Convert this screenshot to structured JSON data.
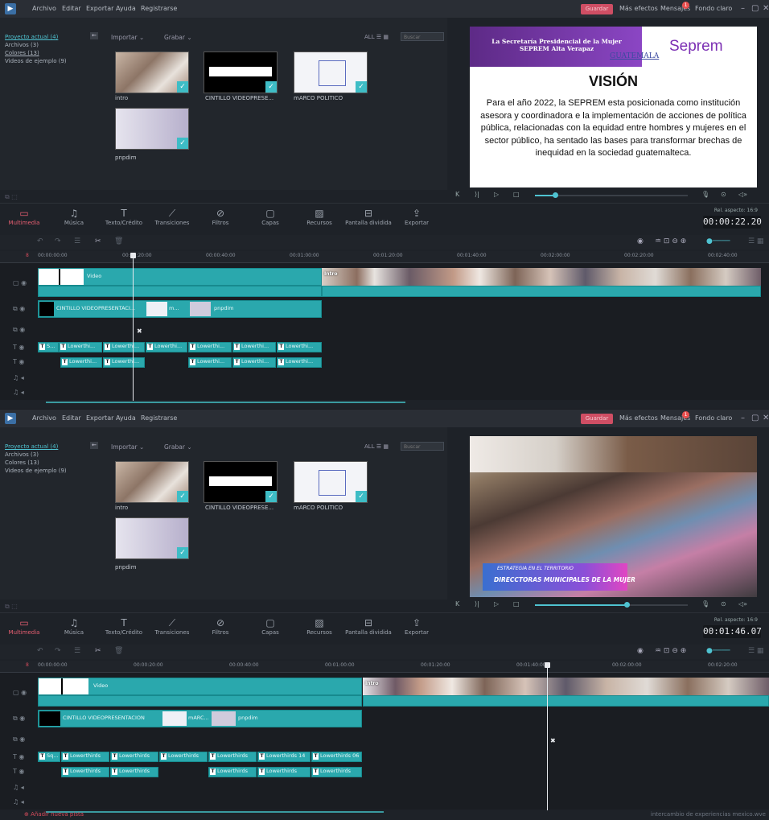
{
  "menu": {
    "items": [
      "Archivo",
      "Editar",
      "Exportar",
      "Ayuda",
      "Registrarse"
    ],
    "save": "Guardar",
    "more_effects": "Más efectos",
    "messages": "Mensajes",
    "messages_badge": "1",
    "theme": "Fondo claro"
  },
  "library": {
    "project": "Proyecto actual (4)",
    "archives": "Archivos (3)",
    "colors": "Colores (13)",
    "samples": "Videos de ejemplo (9)",
    "import": "Importar",
    "record": "Grabar",
    "all": "ALL",
    "search_placeholder": "Buscar",
    "items": [
      {
        "label": "intro",
        "kind": "photo"
      },
      {
        "label": "CINTILLO VIDEOPRESE...",
        "kind": "banner"
      },
      {
        "label": "mARCO POLITICO",
        "kind": "diagram"
      },
      {
        "label": "pnpdim",
        "kind": "slide"
      }
    ]
  },
  "preview_a": {
    "header_left": "La Secretaría Presidencial de la Mujer\nSEPREM Alta Verapaz",
    "guatemala": "GUATEMALA",
    "brand": "Seprem",
    "title": "VISIÓN",
    "body": "Para el año 2022, la SEPREM esta posicionada como institución asesora y coordinadora e la implementación de acciones de política pública, relacionadas con la equidad entre hombres y mujeres en el sector público, ha sentado las bases para transformar brechas de inequidad en la sociedad guatemalteca.",
    "progress": 0.13
  },
  "preview_b": {
    "caption_line1": "ESTRATEGIA EN EL TERRITORIO",
    "caption_line2": "DIRECCTORAS MUNICIPALES DE LA MUJER",
    "progress": 0.6
  },
  "toolbar": {
    "tools": [
      "Multimedia",
      "Música",
      "Texto/Crédito",
      "Transiciones",
      "Filtros",
      "Capas",
      "Recursos",
      "Pantalla dividida",
      "Exportar"
    ],
    "ratio": "Rel. aspecto: 16:9"
  },
  "shot_a": {
    "timecode": "00:00:22.20",
    "ruler": [
      "00:00:00:00",
      "00:00:20:00",
      "00:00:40:00",
      "00:01:00:00",
      "00:01:20:00",
      "00:01:40:00",
      "00:02:00:00",
      "00:02:20:00",
      "00:02:40:00"
    ],
    "clips": {
      "title1": "Video",
      "intro": "Intro",
      "cintillo": "CINTILLO VIDEOPRESENTACI...",
      "marco": "m...",
      "pnpdim": "pnpdim",
      "t1": [
        "S...",
        "Lowerthi...",
        "Lowerthi...",
        "Lowerthi...",
        "Lowerthi...",
        "Lowerthi...",
        "Lowerthi..."
      ],
      "t2": [
        "Lowerthi...",
        "Lowerthi...",
        "Lowerthi...",
        "Lowerthi...",
        "Lowerthi..."
      ]
    }
  },
  "shot_b": {
    "timecode": "00:01:46.07",
    "ruler": [
      "00:00:00:00",
      "00:00:20:00",
      "00:00:40:00",
      "00:01:00:00",
      "00:01:20:00",
      "00:01:40:00",
      "00:02:00:00",
      "00:02:20:00"
    ],
    "clips": {
      "title1": "Video",
      "intro": "Intro",
      "cintillo": "CINTILLO VIDEOPRESENTACION",
      "marco": "mARC...",
      "pnpdim": "pnpdim",
      "t1": [
        "Sq...",
        "Lowerthirds",
        "Lowerthirds",
        "Lowerthirds",
        "Lowerthirds",
        "Lowerthirds 14",
        "Lowerthirds 06"
      ],
      "t2": [
        "Lowerthirds",
        "Lowerthirds",
        "Lowerthirds",
        "Lowerthirds",
        "Lowerthirds"
      ]
    },
    "add_track": "Añadir nueva pista",
    "watermark": "intercambio de experiencias mexico.wve"
  }
}
